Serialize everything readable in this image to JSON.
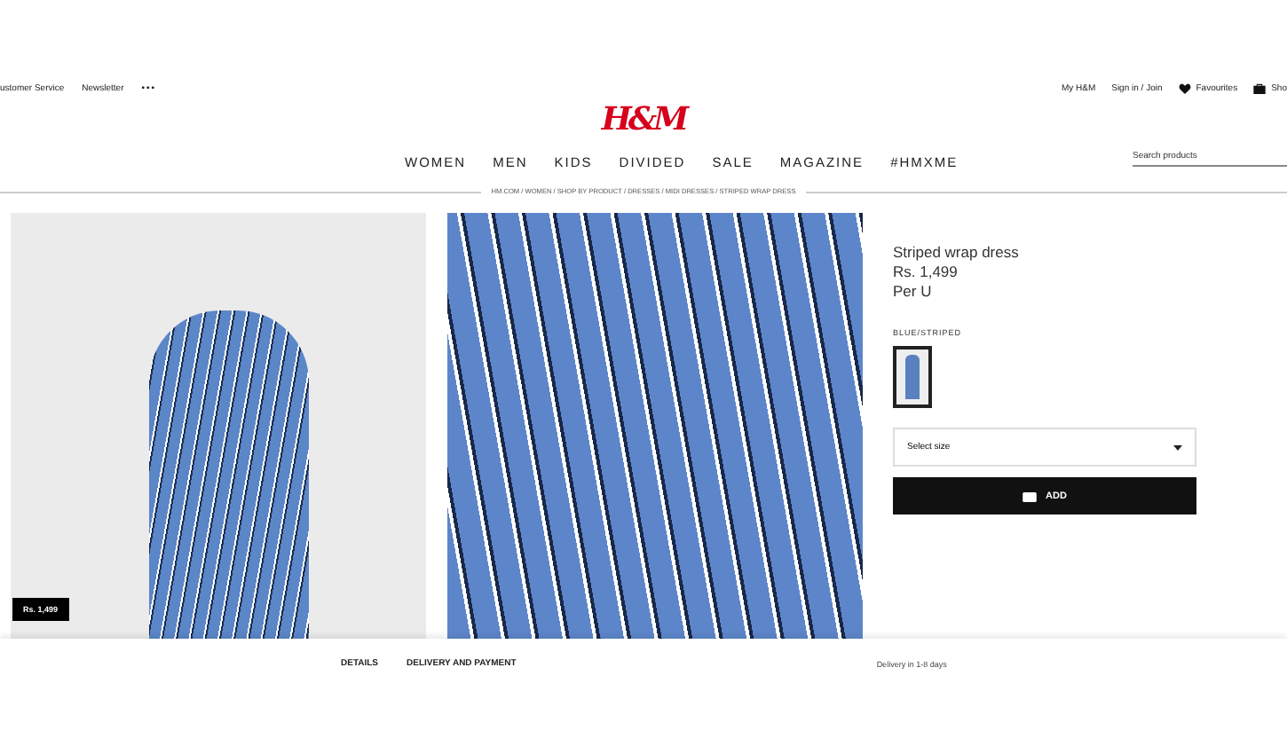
{
  "top_bar": {
    "left_links": [
      "ustomer Service",
      "Newsletter"
    ],
    "more": "•••",
    "right_links": [
      "My H&M",
      "Sign in / Join",
      "Favourites",
      "Sho"
    ]
  },
  "logo": "H&M",
  "nav": [
    "WOMEN",
    "MEN",
    "KIDS",
    "DIVIDED",
    "SALE",
    "MAGAZINE",
    "#HMXME"
  ],
  "search": {
    "placeholder": "Search products"
  },
  "breadcrumb": "HM.COM / WOMEN / SHOP BY PRODUCT / DRESSES / MIDI DRESSES / STRIPED WRAP DRESS",
  "gallery": {
    "price_badge": "Rs. 1,499"
  },
  "product": {
    "name": "Striped wrap dress",
    "price": "Rs. 1,499",
    "unit": "Per U",
    "color_label": "BLUE/STRIPED",
    "swatches": [
      {
        "selected": true
      }
    ],
    "size_select": "Select size",
    "add_button": "ADD"
  },
  "bottom_bar": {
    "tabs": [
      "DETAILS",
      "DELIVERY AND PAYMENT"
    ],
    "delivery": "Delivery in 1-8 days"
  }
}
